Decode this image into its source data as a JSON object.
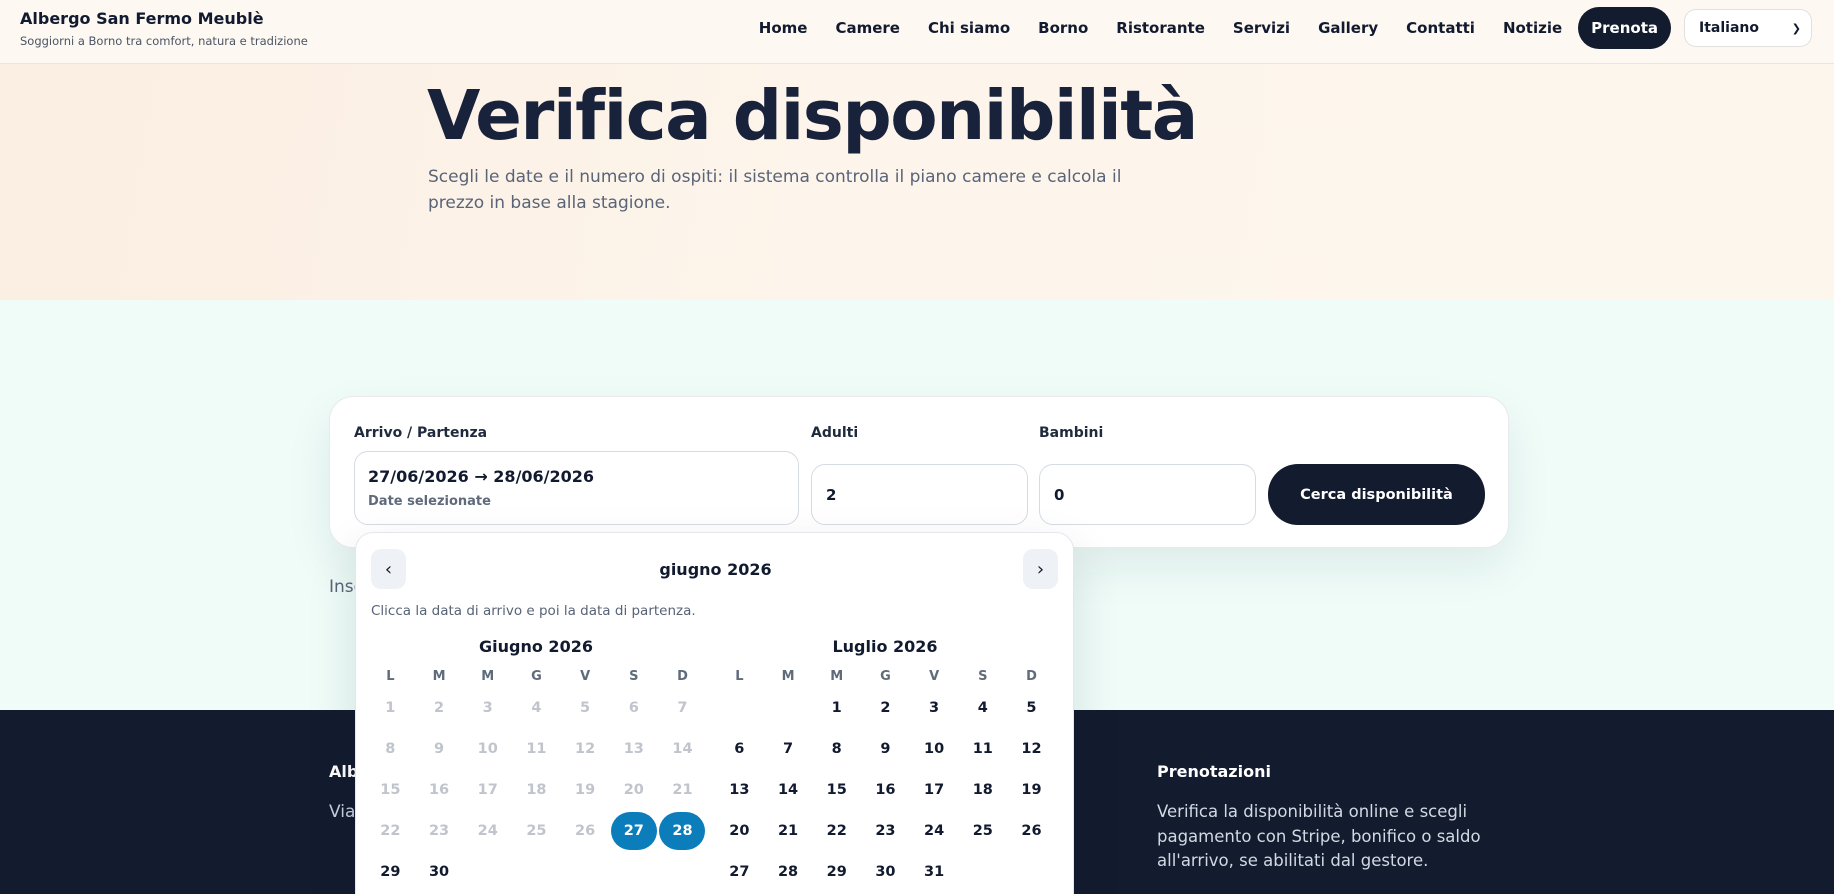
{
  "header": {
    "brand_name": "Albergo San Fermo Meublè",
    "brand_tagline": "Soggiorni a Borno tra comfort, natura e tradizione",
    "nav": [
      "Home",
      "Camere",
      "Chi siamo",
      "Borno",
      "Ristorante",
      "Servizi",
      "Gallery",
      "Contatti",
      "Notizie"
    ],
    "cta_label": "Prenota",
    "language": "Italiano"
  },
  "hero": {
    "title": "Verifica disponibilità",
    "subtitle": "Scegli le date e il numero di ospiti: il sistema controlla il piano camere e calcola il prezzo in base alla stagione."
  },
  "search": {
    "dates_label": "Arrivo / Partenza",
    "dates_value": "27/06/2026 → 28/06/2026",
    "dates_hint": "Date selezionate",
    "adults_label": "Adulti",
    "adults_value": "2",
    "children_label": "Bambini",
    "children_value": "0",
    "submit_label": "Cerca disponibilità"
  },
  "page_text_visible": "Inse",
  "calendar": {
    "title": "giugno 2026",
    "prev": "‹",
    "next": "›",
    "hint": "Clicca la data di arrivo e poi la data di partenza.",
    "weekdays": [
      "L",
      "M",
      "M",
      "G",
      "V",
      "S",
      "D"
    ],
    "months": [
      {
        "name": "Giugno 2026",
        "offset": 0,
        "days": 30,
        "disabled_through": 26,
        "selected": [
          27,
          28
        ]
      },
      {
        "name": "Luglio 2026",
        "offset": 2,
        "days": 31,
        "disabled_through": 0,
        "selected": []
      }
    ]
  },
  "footer": {
    "col1_heading_visible": "Alb",
    "col1_text_visible": "Via",
    "bookings_heading": "Prenotazioni",
    "bookings_text": "Verifica la disponibilità online e scegli pagamento con Stripe, bonifico o saldo all'arrivo, se abilitati dal gestore."
  }
}
